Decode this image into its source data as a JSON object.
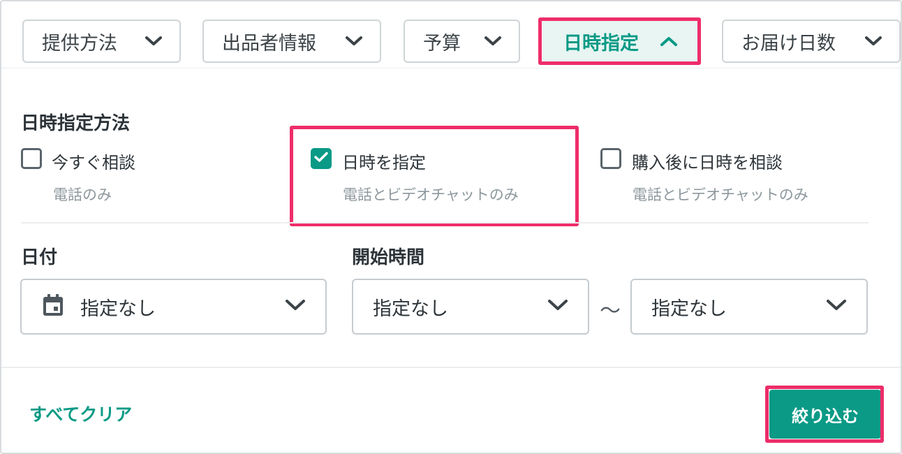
{
  "tabs": [
    {
      "label": "提供方法"
    },
    {
      "label": "出品者情報"
    },
    {
      "label": "予算"
    },
    {
      "label": "日時指定",
      "active": true
    },
    {
      "label": "お届け日数"
    }
  ],
  "method": {
    "title": "日時指定方法",
    "options": [
      {
        "label": "今すぐ相談",
        "sub": "電話のみ",
        "checked": false
      },
      {
        "label": "日時を指定",
        "sub": "電話とビデオチャットのみ",
        "checked": true
      },
      {
        "label": "購入後に日時を相談",
        "sub": "電話とビデオチャットのみ",
        "checked": false
      }
    ]
  },
  "date": {
    "title": "日付",
    "value": "指定なし",
    "icon": "calendar-icon"
  },
  "start_time": {
    "title": "開始時間",
    "from_value": "指定なし",
    "separator": "〜",
    "to_value": "指定なし"
  },
  "footer": {
    "clear_label": "すべてクリア",
    "apply_label": "絞り込む"
  },
  "colors": {
    "accent": "#0a9a86",
    "highlight": "#ee2d6a",
    "active_tab_bg": "#e8f5f2"
  }
}
